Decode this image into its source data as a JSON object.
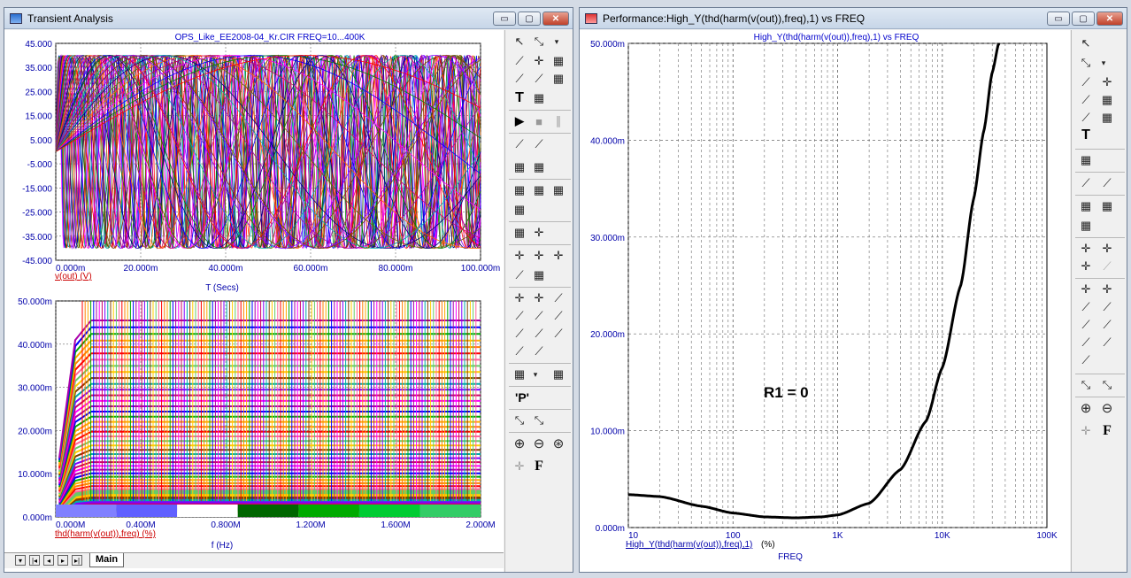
{
  "left_window": {
    "title": "Transient Analysis",
    "top_plot": {
      "title": "OPS_Like_EE2008-04_Kr.CIR FREQ=10...400K",
      "y_ticks": [
        "45.000",
        "35.000",
        "25.000",
        "15.000",
        "5.000",
        "-5.000",
        "-15.000",
        "-25.000",
        "-35.000",
        "-45.000"
      ],
      "x_ticks": [
        "0.000m",
        "20.000m",
        "40.000m",
        "60.000m",
        "80.000m",
        "100.000m"
      ],
      "trace_label": "v(out) (V)",
      "x_axis_label": "T (Secs)"
    },
    "bottom_plot": {
      "y_ticks": [
        "50.000m",
        "40.000m",
        "30.000m",
        "20.000m",
        "10.000m",
        "0.000m"
      ],
      "x_ticks": [
        "0.000M",
        "0.400M",
        "0.800M",
        "1.200M",
        "1.600M",
        "2.000M"
      ],
      "trace_label": "thd(harm(v(out)),freq) (%)",
      "x_axis_label": "f (Hz)"
    },
    "tab_label": "Main"
  },
  "right_window": {
    "title": "Performance:High_Y(thd(harm(v(out)),freq),1) vs FREQ",
    "plot_title": "High_Y(thd(harm(v(out)),freq),1) vs FREQ",
    "y_ticks": [
      "50.000m",
      "40.000m",
      "30.000m",
      "20.000m",
      "10.000m",
      "0.000m"
    ],
    "x_ticks": [
      "10",
      "100",
      "1K",
      "10K",
      "100K"
    ],
    "trace_label": "High_Y(thd(harm(v(out)),freq),1)",
    "trace_unit": "(%)",
    "x_axis_label": "FREQ",
    "annotation": "R1 = 0"
  },
  "window_buttons": {
    "minimize": "▭",
    "maximize": "▢",
    "close": "✕"
  },
  "toolbar_icons": {
    "select": "↖",
    "scale": "⤡",
    "text": "T",
    "run": "▶",
    "stop": "■",
    "pause": "∥",
    "zoom_in": "⊕",
    "zoom_out": "⊖",
    "zoom_fit": "⊛",
    "font": "F",
    "peek": "'P'",
    "grid": "▦",
    "line": "⟋",
    "cursor": "✛"
  },
  "colors": {
    "axis_text": "#0000aa",
    "trace_label": "#cc0000",
    "title_text": "#0000cc",
    "grid": "#6a6a6a",
    "curve": "#000000"
  },
  "chart_data": [
    {
      "type": "line",
      "title": "OPS_Like_EE2008-04_Kr.CIR FREQ=10...400K",
      "xlabel": "T (Secs)",
      "ylabel": "",
      "xlim": [
        0,
        0.1
      ],
      "ylim": [
        -45,
        45
      ],
      "series": [
        {
          "name": "v(out) (V)",
          "description_values": "family of sine sweeps with amplitude ~40",
          "values": [
            40,
            -40
          ]
        }
      ]
    },
    {
      "type": "line",
      "title": "",
      "xlabel": "f (Hz)",
      "ylabel": "",
      "xlim": [
        0,
        2000000
      ],
      "ylim": [
        0,
        0.05
      ],
      "series": [
        {
          "name": "thd(harm(v(out)),freq) (%)",
          "values": [
            0.002,
            0.05
          ]
        }
      ]
    },
    {
      "type": "line",
      "title": "High_Y(thd(harm(v(out)),freq),1) vs FREQ",
      "xlabel": "FREQ",
      "ylabel": "",
      "xscale": "log",
      "xlim": [
        10,
        100000
      ],
      "ylim": [
        0,
        0.05
      ],
      "x": [
        10,
        20,
        50,
        100,
        200,
        400,
        700,
        1000,
        2000,
        4000,
        7000,
        10000,
        15000,
        20000,
        25000,
        30000,
        35000
      ],
      "series": [
        {
          "name": "High_Y(thd(harm(v(out)),freq),1)",
          "values": [
            0.0034,
            0.0032,
            0.0022,
            0.0015,
            0.0011,
            0.001,
            0.0011,
            0.0013,
            0.0025,
            0.006,
            0.011,
            0.0165,
            0.025,
            0.034,
            0.041,
            0.047,
            0.0502
          ]
        }
      ]
    }
  ]
}
